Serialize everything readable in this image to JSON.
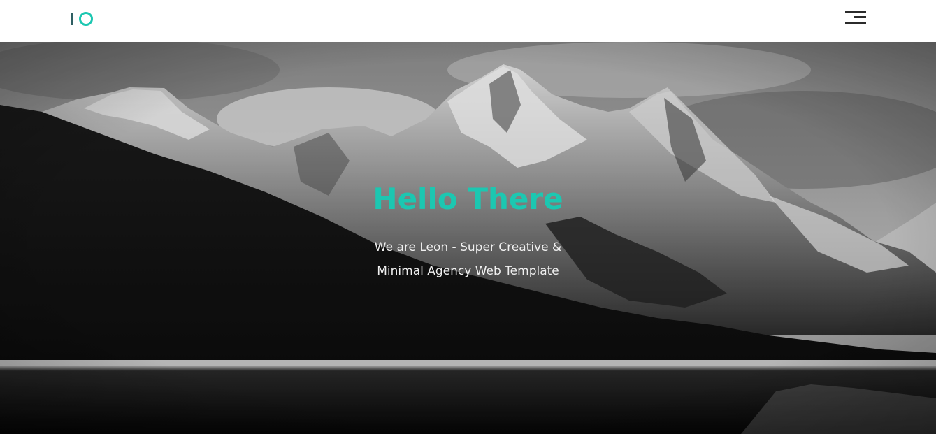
{
  "header": {
    "logo_name": "logo-io",
    "menu_icon": "hamburger-menu-icon"
  },
  "hero": {
    "title": "Hello There",
    "subtitle_line1": "We are Leon - Super Creative &",
    "subtitle_line2": "Minimal Agency Web Template",
    "background": "black-and-white mountain lake photo"
  },
  "colors": {
    "accent": "#1cc7b1",
    "logo_dark": "#2f5f63",
    "header_bg": "#ffffff"
  }
}
